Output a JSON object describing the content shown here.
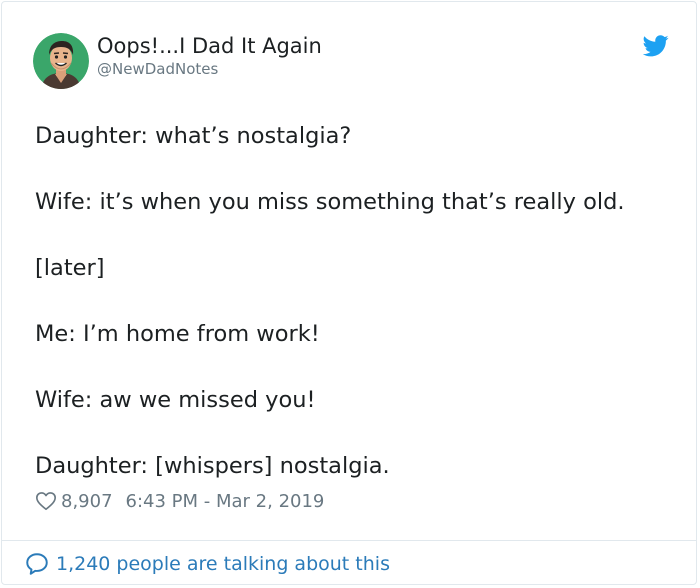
{
  "author": {
    "name": "Oops!...I Dad It Again",
    "handle": "@NewDadNotes"
  },
  "icons": {
    "avatar": "avatar-illustration",
    "brand": "twitter-bird-icon",
    "like": "heart-icon",
    "conversation": "speech-bubble-icon"
  },
  "colors": {
    "brand": "#1da1f2",
    "link": "#2b7bb9",
    "text": "#1c2022",
    "secondary": "#697882",
    "avatar_bg": "#3aa66a"
  },
  "tweet": {
    "lines": [
      "Daughter: what’s nostalgia?",
      "Wife: it’s when you miss something that’s really old.",
      "[later]",
      "Me: I’m home from work!",
      "Wife: aw we missed you!",
      "Daughter: [whispers] nostalgia."
    ]
  },
  "meta": {
    "likes": "8,907",
    "timestamp": "6:43 PM - Mar 2, 2019"
  },
  "footer": {
    "talking": "1,240 people are talking about this"
  }
}
